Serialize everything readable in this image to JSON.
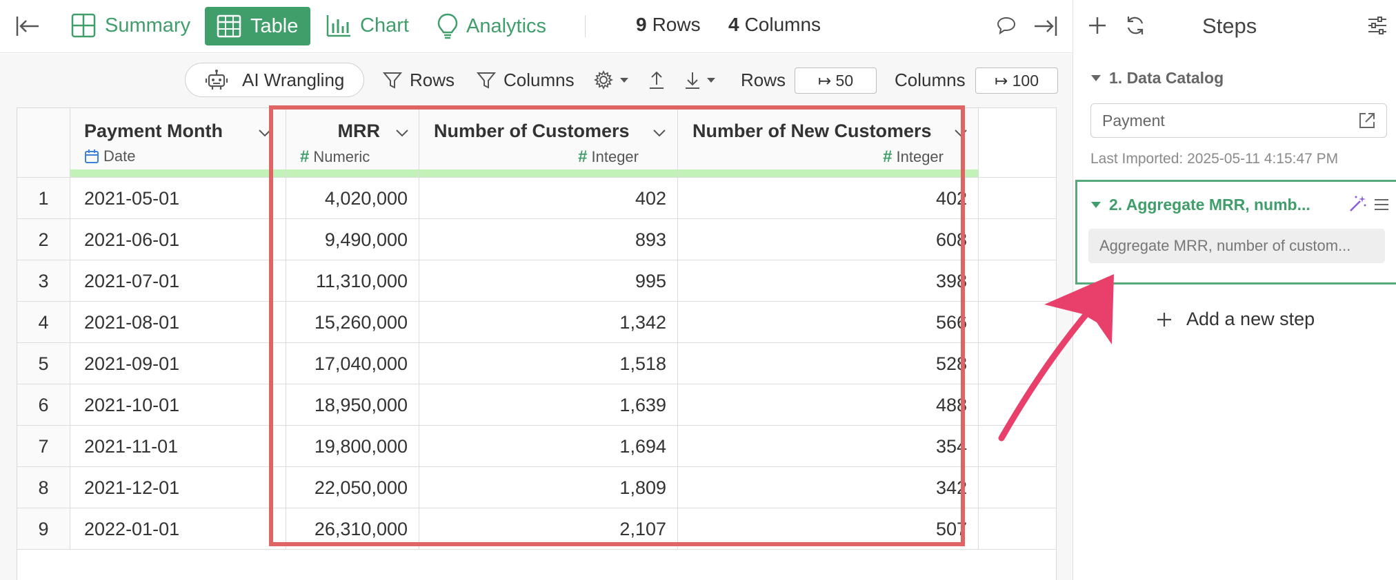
{
  "toolbar": {
    "tabs": [
      {
        "label": "Summary",
        "icon": "summary-grid-icon"
      },
      {
        "label": "Table",
        "icon": "table-icon",
        "active": true
      },
      {
        "label": "Chart",
        "icon": "bar-chart-icon"
      },
      {
        "label": "Analytics",
        "icon": "lightbulb-icon"
      }
    ],
    "rows_count": "9",
    "rows_label": "Rows",
    "cols_count": "4",
    "cols_label": "Columns"
  },
  "toolbar2": {
    "ai_label": "AI Wrangling",
    "rows_filter": "Rows",
    "cols_filter": "Columns",
    "rows_label": "Rows",
    "rows_value": "↦ 50",
    "cols_label": "Columns",
    "cols_value": "↦ 100"
  },
  "table": {
    "columns": [
      {
        "name": "Payment Month",
        "type": "Date"
      },
      {
        "name": "MRR",
        "type": "Numeric"
      },
      {
        "name": "Number of Customers",
        "type": "Integer"
      },
      {
        "name": "Number of New Customers",
        "type": "Integer"
      }
    ],
    "rows": [
      [
        "1",
        "2021-05-01",
        "4,020,000",
        "402",
        "402"
      ],
      [
        "2",
        "2021-06-01",
        "9,490,000",
        "893",
        "608"
      ],
      [
        "3",
        "2021-07-01",
        "11,310,000",
        "995",
        "398"
      ],
      [
        "4",
        "2021-08-01",
        "15,260,000",
        "1,342",
        "566"
      ],
      [
        "5",
        "2021-09-01",
        "17,040,000",
        "1,518",
        "528"
      ],
      [
        "6",
        "2021-10-01",
        "18,950,000",
        "1,639",
        "488"
      ],
      [
        "7",
        "2021-11-01",
        "19,800,000",
        "1,694",
        "354"
      ],
      [
        "8",
        "2021-12-01",
        "22,050,000",
        "1,809",
        "342"
      ],
      [
        "9",
        "2022-01-01",
        "26,310,000",
        "2,107",
        "507"
      ]
    ]
  },
  "steps": {
    "title": "Steps",
    "step1_title": "1. Data Catalog",
    "step1_source": "Payment",
    "last_imported": "Last Imported: 2025-05-11 4:15:47 PM",
    "step2_title": "2. Aggregate MRR, numb...",
    "step2_desc": "Aggregate MRR, number of custom...",
    "add_step": "Add a new step"
  },
  "colors": {
    "accent": "#3f9e6a",
    "highlight_outline": "#e06464",
    "arrow": "#e8406a",
    "header_strip": "#c2f2b8"
  }
}
